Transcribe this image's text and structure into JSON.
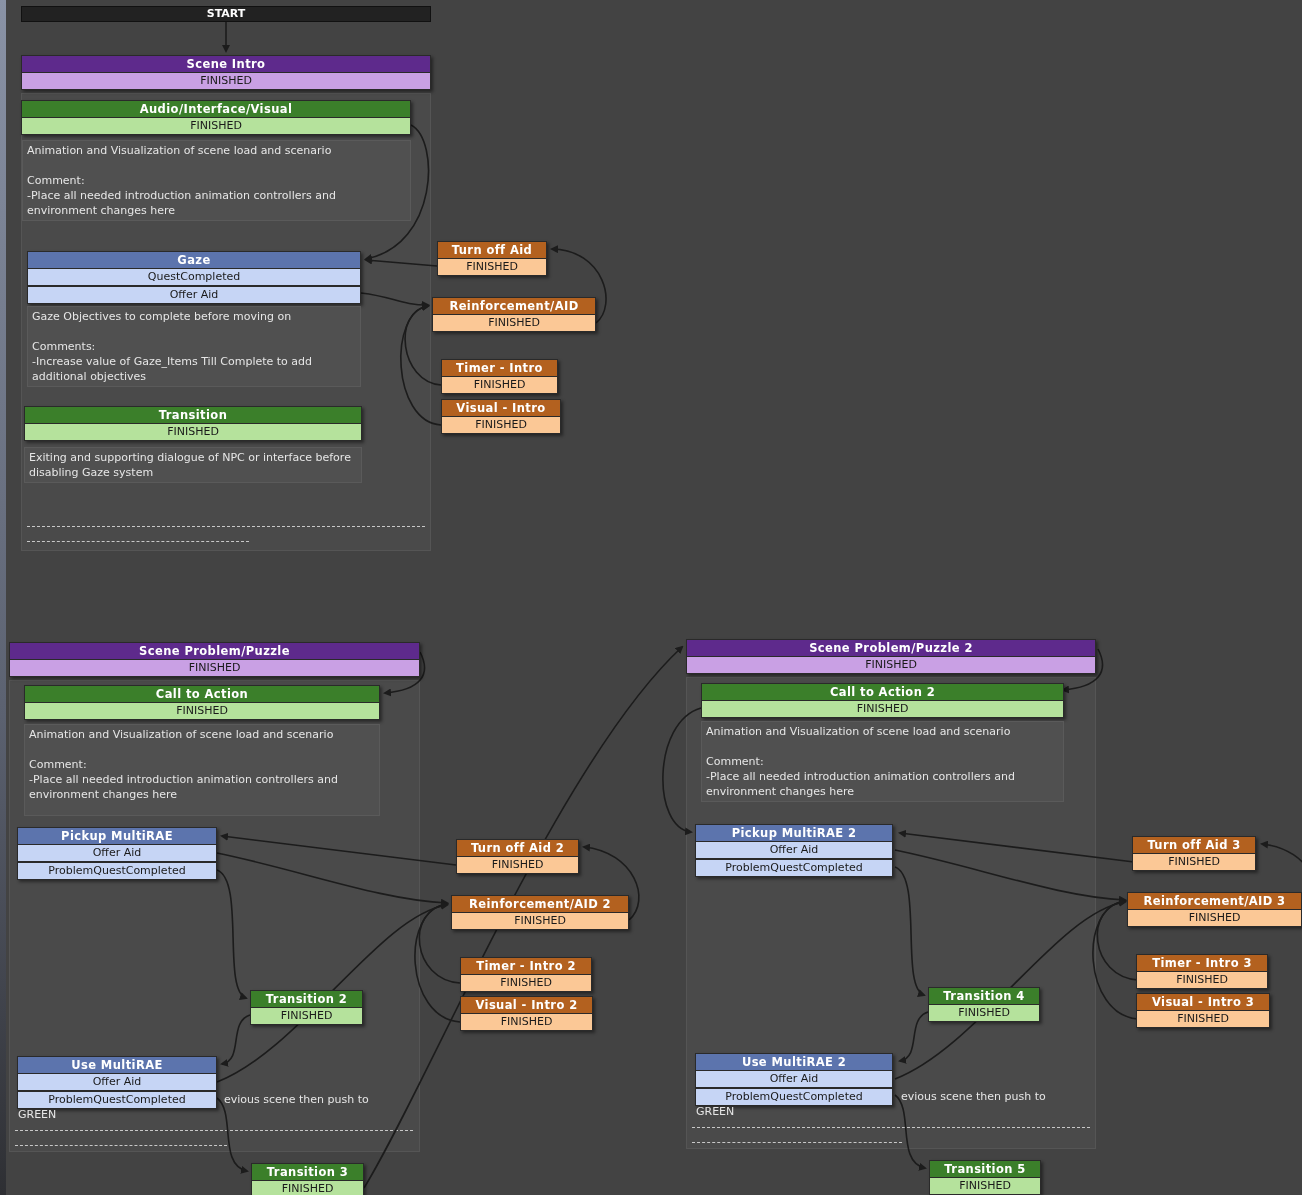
{
  "start": {
    "label": "START"
  },
  "nodes": [
    {
      "kind": "scene",
      "title": "Scene Intro",
      "rows": [
        "FINISHED"
      ]
    },
    {
      "kind": "action",
      "title": "Audio/Interface/Visual",
      "rows": [
        "FINISHED"
      ]
    },
    {
      "kind": "objective",
      "title": "Gaze",
      "rows": [
        "QuestCompleted",
        "Offer Aid"
      ]
    },
    {
      "kind": "aid",
      "title": "Turn off Aid",
      "rows": [
        "FINISHED"
      ]
    },
    {
      "kind": "aid",
      "title": "Reinforcement/AID",
      "rows": [
        "FINISHED"
      ]
    },
    {
      "kind": "aid",
      "title": "Timer - Intro",
      "rows": [
        "FINISHED"
      ]
    },
    {
      "kind": "aid",
      "title": "Visual - Intro",
      "rows": [
        "FINISHED"
      ]
    },
    {
      "kind": "action",
      "title": "Transition",
      "rows": [
        "FINISHED"
      ]
    },
    {
      "kind": "scene",
      "title": "Scene Problem/Puzzle",
      "rows": [
        "FINISHED"
      ]
    },
    {
      "kind": "action",
      "title": "Call to Action",
      "rows": [
        "FINISHED"
      ]
    },
    {
      "kind": "objective",
      "title": "Pickup MultiRAE",
      "rows": [
        "Offer Aid",
        "ProblemQuestCompleted"
      ]
    },
    {
      "kind": "aid",
      "title": "Turn off Aid 2",
      "rows": [
        "FINISHED"
      ]
    },
    {
      "kind": "aid",
      "title": "Reinforcement/AID 2",
      "rows": [
        "FINISHED"
      ]
    },
    {
      "kind": "aid",
      "title": "Timer - Intro 2",
      "rows": [
        "FINISHED"
      ]
    },
    {
      "kind": "aid",
      "title": "Visual - Intro 2",
      "rows": [
        "FINISHED"
      ]
    },
    {
      "kind": "action",
      "title": "Transition 2",
      "rows": [
        "FINISHED"
      ]
    },
    {
      "kind": "objective",
      "title": "Use MultiRAE",
      "rows": [
        "Offer Aid",
        "ProblemQuestCompleted"
      ]
    },
    {
      "kind": "action",
      "title": "Transition 3",
      "rows": [
        "FINISHED"
      ]
    },
    {
      "kind": "scene",
      "title": "Scene Problem/Puzzle 2",
      "rows": [
        "FINISHED"
      ]
    },
    {
      "kind": "action",
      "title": "Call to Action 2",
      "rows": [
        "FINISHED"
      ]
    },
    {
      "kind": "objective",
      "title": "Pickup MultiRAE 2",
      "rows": [
        "Offer Aid",
        "ProblemQuestCompleted"
      ]
    },
    {
      "kind": "aid",
      "title": "Turn off Aid 3",
      "rows": [
        "FINISHED"
      ]
    },
    {
      "kind": "aid",
      "title": "Reinforcement/AID 3",
      "rows": [
        "FINISHED"
      ]
    },
    {
      "kind": "aid",
      "title": "Timer - Intro 3",
      "rows": [
        "FINISHED"
      ]
    },
    {
      "kind": "aid",
      "title": "Visual - Intro 3",
      "rows": [
        "FINISHED"
      ]
    },
    {
      "kind": "action",
      "title": "Transition 4",
      "rows": [
        "FINISHED"
      ]
    },
    {
      "kind": "objective",
      "title": "Use MultiRAE 2",
      "rows": [
        "Offer Aid",
        "ProblemQuestCompleted"
      ]
    },
    {
      "kind": "action",
      "title": "Transition 5",
      "rows": [
        "FINISHED"
      ]
    }
  ],
  "notes": [
    {
      "text": "Animation and Visualization of scene load and scenario\n\nComment:\n-Place all needed introduction animation controllers and environment changes here"
    },
    {
      "text": "Gaze Objectives to complete before moving on\n\nComments:\n-Increase value of Gaze_Items Till Complete to add additional objectives"
    },
    {
      "text": "Exiting and supporting dialogue of NPC or interface before disabling Gaze system"
    },
    {
      "text": "Animation and Visualization of scene load and scenario\n\nComment:\n-Place all needed introduction animation controllers and environment changes here"
    },
    {
      "text": "evious scene then push to"
    },
    {
      "text": "GREEN"
    },
    {
      "text": "Animation and Visualization of scene load and scenario\n\nComment:\n-Place all needed introduction animation controllers and environment changes here"
    },
    {
      "text": "evious scene then push to"
    },
    {
      "text": "GREEN"
    }
  ]
}
